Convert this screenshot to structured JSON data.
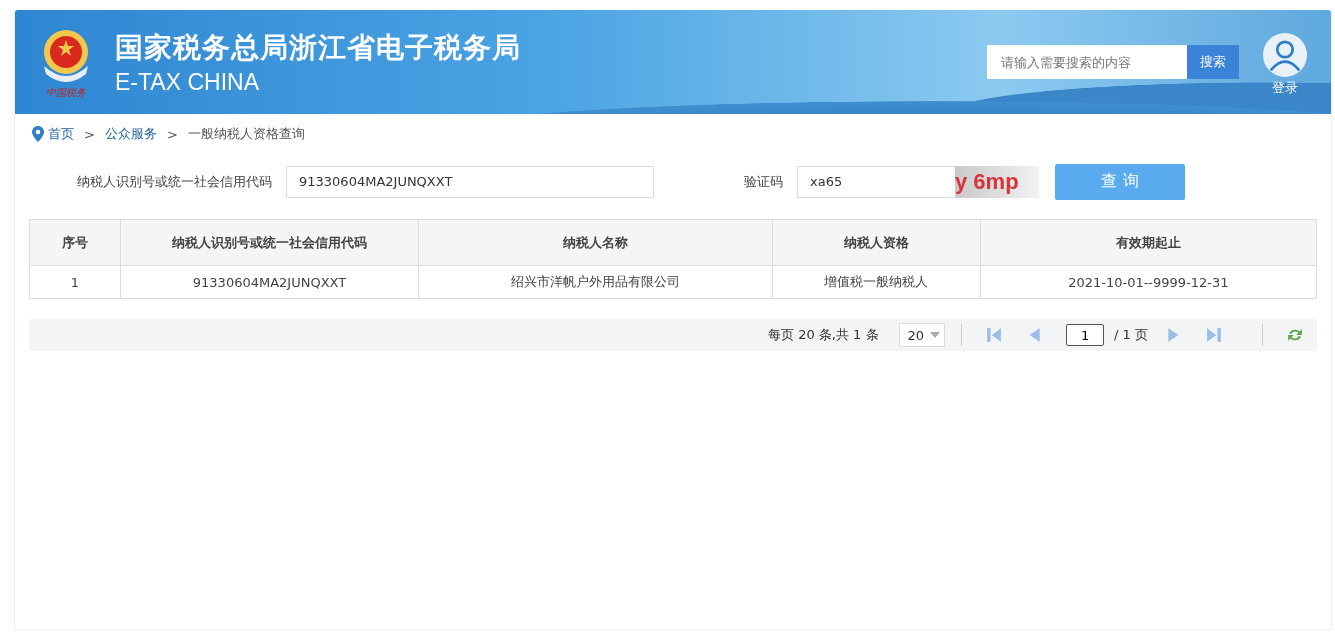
{
  "header": {
    "title": "国家税务总局浙江省电子税务局",
    "subtitle": "E-TAX CHINA",
    "emblem_caption": "中国税务",
    "search": {
      "placeholder": "请输入需要搜索的内容",
      "button": "搜索"
    },
    "login": "登录"
  },
  "breadcrumb": {
    "items": [
      {
        "label": "首页",
        "kind": "link"
      },
      {
        "label": "公众服务",
        "kind": "link"
      },
      {
        "label": "一般纳税人资格查询",
        "kind": "current"
      }
    ],
    "separators": [
      ">",
      ">"
    ]
  },
  "form": {
    "id_label": "纳税人识别号或统一社会信用代码",
    "id_value": "91330604MA2JUNQXXT",
    "captcha_label": "验证码",
    "captcha_value": "xa65",
    "captcha_image_text": "y 6mp",
    "submit": "查 询"
  },
  "table": {
    "columns": [
      "序号",
      "纳税人识别号或统一社会信用代码",
      "纳税人名称",
      "纳税人资格",
      "有效期起止"
    ],
    "rows": [
      [
        "1",
        "91330604MA2JUNQXXT",
        "绍兴市洋帆户外用品有限公司",
        "增值税一般纳税人",
        "2021-10-01--9999-12-31"
      ]
    ]
  },
  "pager": {
    "summary": "每页 20 条,共 1 条",
    "page_size": "20",
    "page": "1",
    "total_pages": "/ 1 页"
  }
}
